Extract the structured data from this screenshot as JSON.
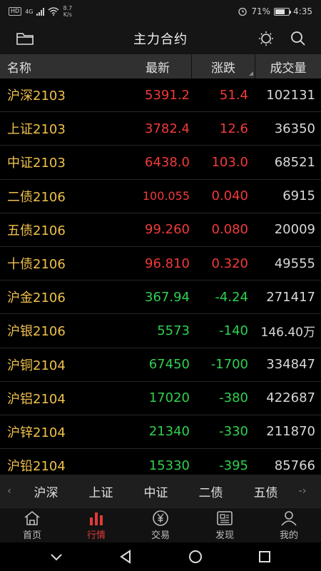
{
  "status": {
    "network": "4G",
    "hd": "HD",
    "speed_value": "8.7",
    "speed_unit": "K/s",
    "battery": "71%",
    "time": "4:35"
  },
  "title_bar": {
    "title": "主力合约"
  },
  "table": {
    "headers": {
      "name": "名称",
      "last": "最新",
      "change": "涨跌",
      "volume": "成交量"
    },
    "rows": [
      {
        "name": "沪深2103",
        "last": "5391.2",
        "change": "51.4",
        "volume": "102131",
        "trend": "up"
      },
      {
        "name": "上证2103",
        "last": "3782.4",
        "change": "12.6",
        "volume": "36350",
        "trend": "up"
      },
      {
        "name": "中证2103",
        "last": "6438.0",
        "change": "103.0",
        "volume": "68521",
        "trend": "up"
      },
      {
        "name": "二债2106",
        "last": "100.055",
        "change": "0.040",
        "volume": "6915",
        "trend": "up"
      },
      {
        "name": "五债2106",
        "last": "99.260",
        "change": "0.080",
        "volume": "20009",
        "trend": "up"
      },
      {
        "name": "十债2106",
        "last": "96.810",
        "change": "0.320",
        "volume": "49555",
        "trend": "up"
      },
      {
        "name": "沪金2106",
        "last": "367.94",
        "change": "-4.24",
        "volume": "271417",
        "trend": "down"
      },
      {
        "name": "沪银2106",
        "last": "5573",
        "change": "-140",
        "volume": "146.40万",
        "trend": "down"
      },
      {
        "name": "沪铜2104",
        "last": "67450",
        "change": "-1700",
        "volume": "334847",
        "trend": "down"
      },
      {
        "name": "沪铝2104",
        "last": "17020",
        "change": "-380",
        "volume": "422687",
        "trend": "down"
      },
      {
        "name": "沪锌2104",
        "last": "21340",
        "change": "-330",
        "volume": "211870",
        "trend": "down"
      },
      {
        "name": "沪铅2104",
        "last": "15330",
        "change": "-395",
        "volume": "85766",
        "trend": "down"
      }
    ]
  },
  "quick_tabs": {
    "left_arrow": "‹",
    "right_arrow": "-›",
    "items": [
      "沪深",
      "上证",
      "中证",
      "二债",
      "五债"
    ]
  },
  "bottom_nav": {
    "items": [
      {
        "label": "首页",
        "icon": "home-icon"
      },
      {
        "label": "行情",
        "icon": "market-chart-icon",
        "active": true
      },
      {
        "label": "交易",
        "icon": "yen-coin-icon"
      },
      {
        "label": "发现",
        "icon": "news-card-icon"
      },
      {
        "label": "我的",
        "icon": "user-icon"
      }
    ]
  },
  "colors": {
    "up": "#f23a3a",
    "down": "#2fd04f",
    "name": "#f0c14b",
    "active_nav": "#e23a3a"
  }
}
